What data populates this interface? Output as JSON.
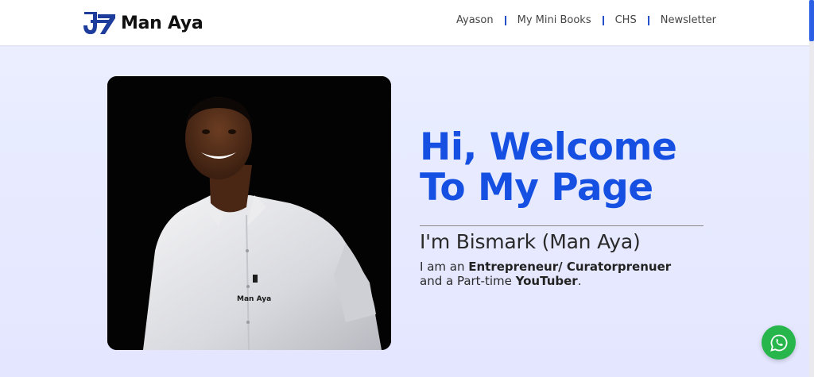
{
  "brand": {
    "logo_text": "Man Aya",
    "color": "#2550c9"
  },
  "nav": {
    "items": [
      {
        "label": "Ayason"
      },
      {
        "label": "My Mini Books"
      },
      {
        "label": "CHS"
      },
      {
        "label": "Newsletter"
      }
    ]
  },
  "hero": {
    "headline_line1": "Hi, Welcome",
    "headline_line2": "To My Page",
    "name": "I'm Bismark (Man Aya)",
    "bio_part1": "I am an ",
    "bio_bold1": "Entrepreneur/ Curatorprenuer",
    "bio_part2": "and a Part-time ",
    "bio_bold2": "YouTuber",
    "bio_end": ".",
    "photo_shirt_logo": "Man Aya",
    "headline_color": "#1650e2"
  },
  "floating": {
    "icon": "whatsapp-icon",
    "color": "#27b64b"
  }
}
